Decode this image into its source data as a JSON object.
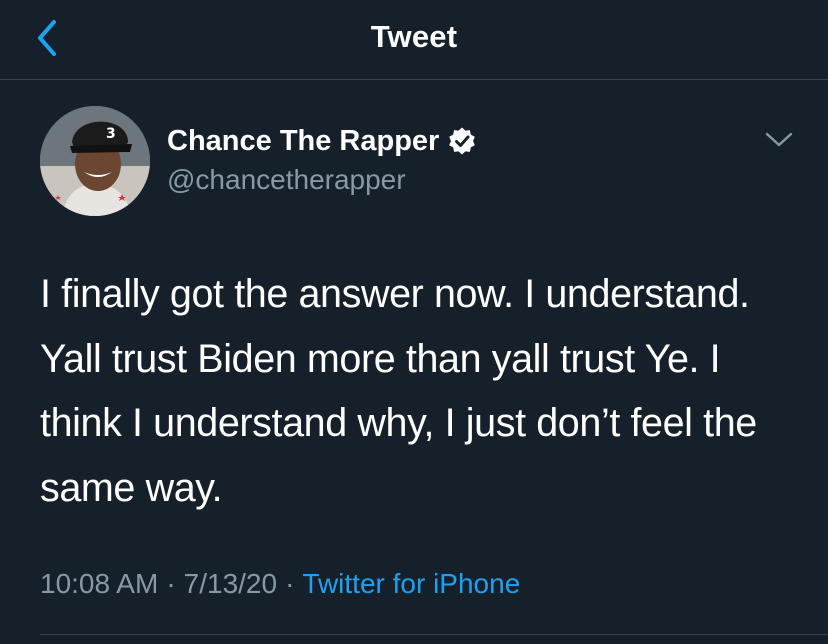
{
  "header": {
    "title": "Tweet",
    "back_icon": "chevron-left-icon"
  },
  "tweet": {
    "author_name": "Chance The Rapper",
    "verified_icon": "verified-badge-icon",
    "handle": "@chancetherapper",
    "text": "I finally got the answer now. I understand. Yall trust Biden more than yall trust Ye. I think I understand why, I just don’t feel the same way.",
    "time": "10:08 AM",
    "date": "7/13/20",
    "separator": "·",
    "source": "Twitter for iPhone"
  },
  "colors": {
    "background": "#15202b",
    "accent": "#1da1f2",
    "secondary_text": "#8899a6",
    "divider": "#38444d"
  }
}
